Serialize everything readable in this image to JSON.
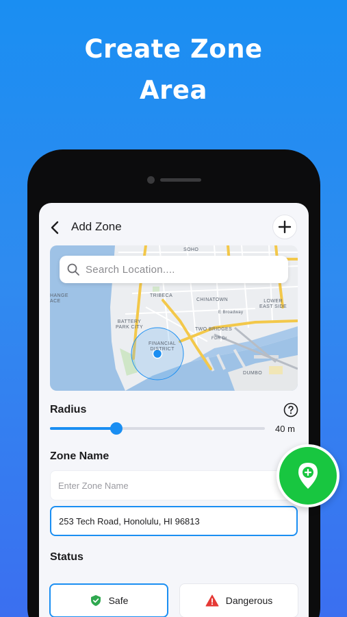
{
  "headline": {
    "line1": "Create Zone",
    "line2": "Area"
  },
  "header": {
    "title": "Add Zone",
    "back_icon": "chevron-left-icon",
    "add_icon": "plus-icon"
  },
  "map": {
    "search_placeholder": "Search Location....",
    "labels": {
      "soho": "SOHO",
      "tribeca": "TRIBECA",
      "chinatown": "CHINATOWN",
      "lower_east_side_1": "LOWER",
      "lower_east_side_2": "EAST SIDE",
      "battery_park_1": "BATTERY",
      "battery_park_2": "PARK CITY",
      "financial_1": "FINANCIAL",
      "financial_2": "DISTRICT",
      "two_bridges": "TWO BRIDGES",
      "dumbo": "DUMBO",
      "exchange_1": "HANGE",
      "exchange_2": "ACE",
      "broadway": "E Broadway",
      "fdr": "FDR Dr"
    }
  },
  "radius": {
    "label": "Radius",
    "value_text": "40 m",
    "fraction": 0.31
  },
  "zone_name": {
    "label": "Zone Name",
    "name_placeholder": "Enter Zone Name",
    "address_value": "253 Tech Road, Honolulu, HI 96813"
  },
  "status": {
    "label": "Status",
    "safe_label": "Safe",
    "danger_label": "Dangerous",
    "selected": "Safe"
  },
  "colors": {
    "accent": "#1a8ef2",
    "fab": "#18c640",
    "safe_icon": "#2fa84f",
    "danger_icon": "#e53935"
  },
  "fab": {
    "icon": "map-pin-plus-icon"
  }
}
